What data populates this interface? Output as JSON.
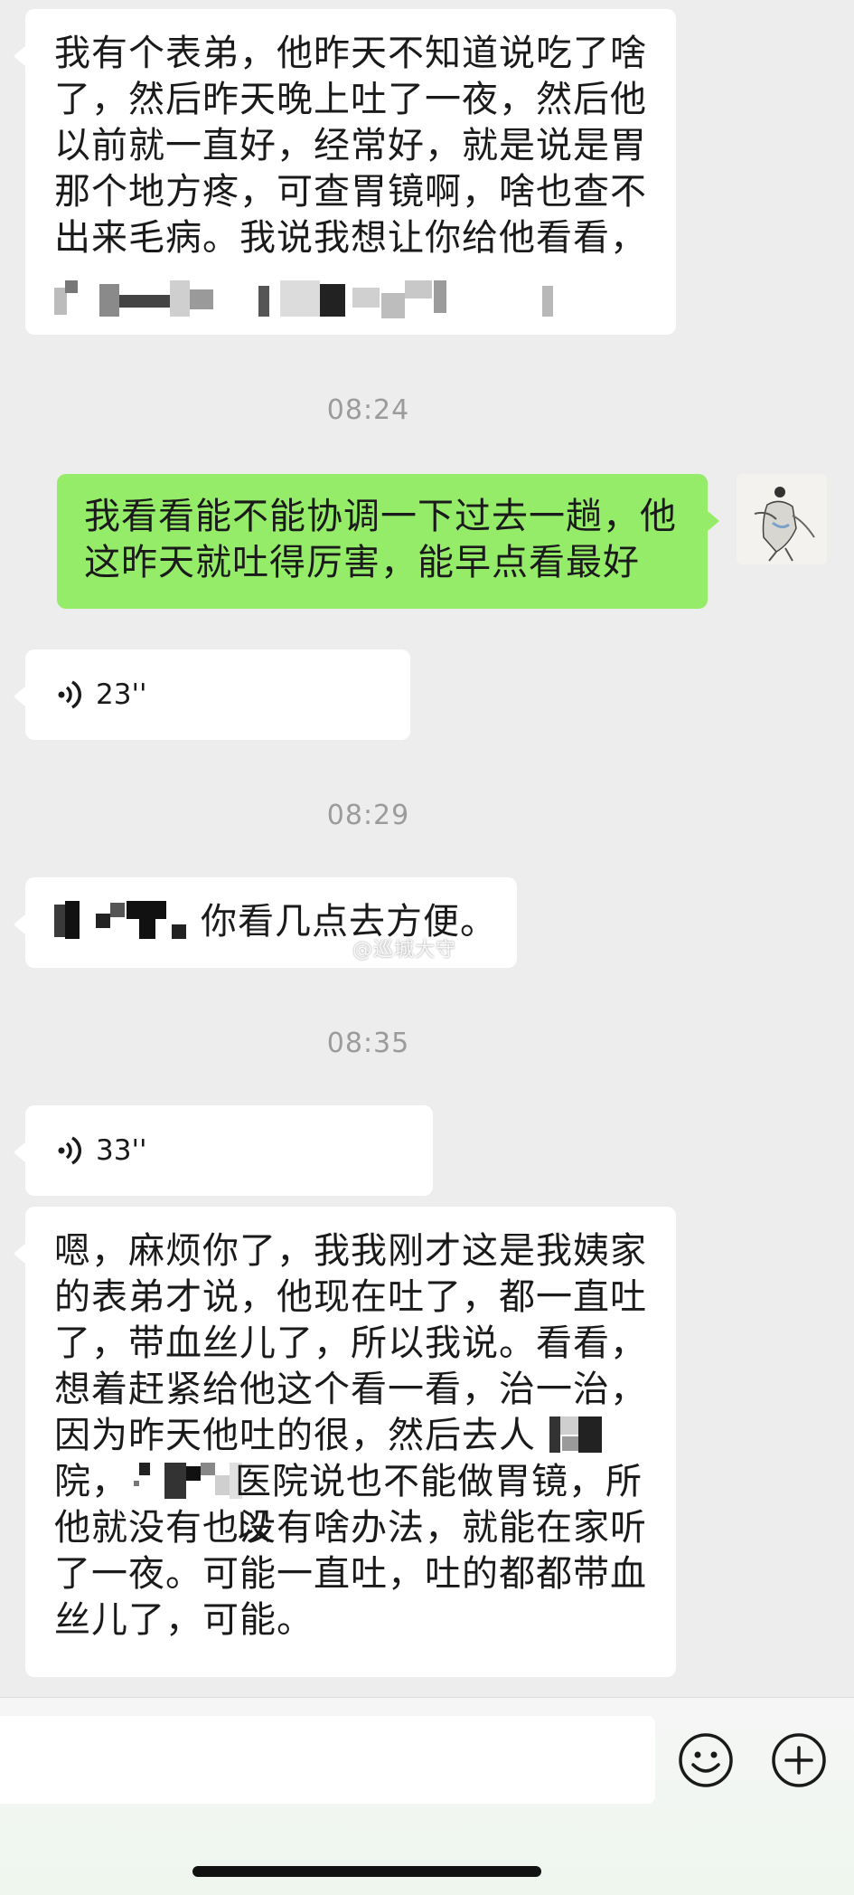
{
  "messages": [
    {
      "type": "text",
      "direction": "received",
      "text": "我有个表弟，他昨天不知道说吃了啥了，然后昨天晚上吐了一夜，然后他以前就一直好，经常好，就是说是胃那个地方疼，可查胃镜啊，啥也查不出来毛病。我说我想让你给他看看，"
    },
    {
      "type": "timestamp",
      "text": "08:24"
    },
    {
      "type": "text",
      "direction": "sent",
      "text": "我看看能不能协调一下过去一趟，他这昨天就吐得厉害，能早点看最好"
    },
    {
      "type": "voice",
      "direction": "received",
      "duration": "23''"
    },
    {
      "type": "timestamp",
      "text": "08:29"
    },
    {
      "type": "text",
      "direction": "received",
      "text": "你看几点去方便。"
    },
    {
      "type": "timestamp",
      "text": "08:35"
    },
    {
      "type": "voice",
      "direction": "received",
      "duration": "33''"
    },
    {
      "type": "text",
      "direction": "received",
      "lines": [
        "嗯，麻烦你了，我我刚才这是我姨家",
        "的表弟才说，他现在吐了，都一直吐",
        "了，带血丝儿了，所以我说。看看，",
        "想着赶紧给他这个看一看，治一治，",
        "因为昨天他吐的很，然后去人",
        "院，",
        "医院说也不能做胃镜，所以",
        "他就没有也没有啥办法，就能在家听",
        "了一夜。可能一直吐，吐的都都带血",
        "丝儿了，可能。"
      ]
    }
  ],
  "watermark": "@巡城大守",
  "input": {
    "value": "",
    "placeholder": ""
  },
  "icons": {
    "voice": "voice-wave-icon",
    "emoji": "smiley-emoji-icon",
    "add": "plus-circle-icon"
  },
  "colors": {
    "background": "#ededed",
    "sent_bubble": "#95ec69",
    "received_bubble": "#ffffff",
    "timestamp": "#9b9b9b"
  }
}
